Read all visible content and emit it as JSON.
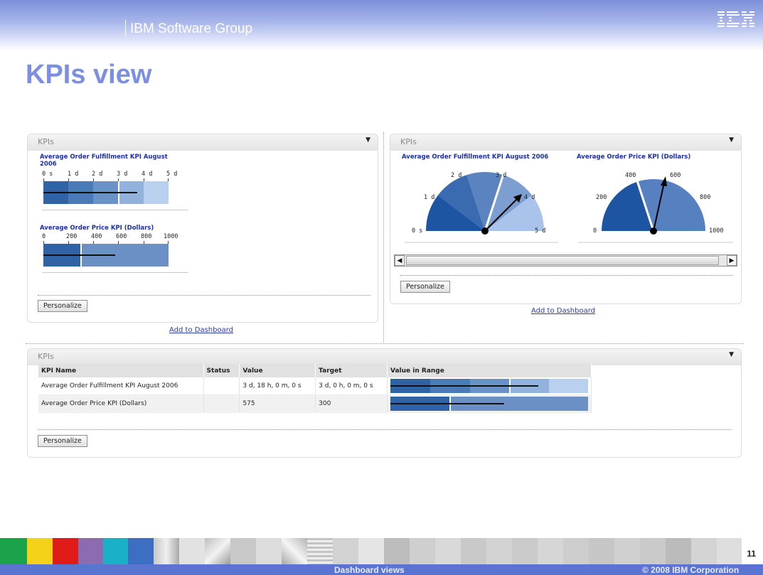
{
  "header": {
    "group": "IBM Software Group",
    "logo": "IBM"
  },
  "title": "KPIs view",
  "portlet_left": {
    "title": "KPIs",
    "menu_icon": "triangle-down",
    "kpi1": {
      "name": "Average Order Fulfillment KPI August 2006",
      "ticks": [
        "0 s",
        "1 d",
        "2 d",
        "3 d",
        "4 d",
        "5 d"
      ],
      "value_fraction": 0.75,
      "target_fraction": 0.6
    },
    "kpi2": {
      "name": "Average Order Price KPI (Dollars)",
      "ticks": [
        "0",
        "200",
        "400",
        "600",
        "800",
        "1000"
      ],
      "value_fraction": 0.575,
      "target_fraction": 0.3
    },
    "personalize": "Personalize",
    "add_link": "Add to Dashboard"
  },
  "portlet_right": {
    "title": "KPIs",
    "kpi1": {
      "name": "Average Order Fulfillment KPI August 2006",
      "ticks": [
        "0 s",
        "1 d",
        "2 d",
        "3 d",
        "4 d",
        "5 d"
      ],
      "value_fraction": 0.75,
      "target_fraction": 0.6
    },
    "kpi2": {
      "name": "Average Order Price KPI (Dollars)",
      "ticks": [
        "0",
        "200",
        "400",
        "600",
        "800",
        "1000"
      ],
      "value_fraction": 0.575,
      "target_fraction": 0.3
    },
    "personalize": "Personalize",
    "add_link": "Add to Dashboard"
  },
  "portlet_bottom": {
    "title": "KPIs",
    "columns": [
      "KPI Name",
      "Status",
      "Value",
      "Target",
      "Value in Range"
    ],
    "rows": [
      {
        "name": "Average Order Fulfillment KPI August 2006",
        "status": "",
        "value": "3 d, 18 h, 0 m, 0 s",
        "target": "3 d, 0 h, 0 m, 0 s",
        "value_fraction": 0.75,
        "target_fraction": 0.6
      },
      {
        "name": "Average Order Price KPI (Dollars)",
        "status": "",
        "value": "575",
        "target": "300",
        "value_fraction": 0.575,
        "target_fraction": 0.3
      }
    ],
    "personalize": "Personalize"
  },
  "footer": {
    "page": "11",
    "center": "Dashboard views",
    "copyright": "© 2008 IBM Corporation"
  },
  "colors": {
    "title": "#7d8fe3",
    "link": "#2d3da8",
    "kpi_title": "#1a2fb0",
    "footer_band": "#5a74d2"
  }
}
